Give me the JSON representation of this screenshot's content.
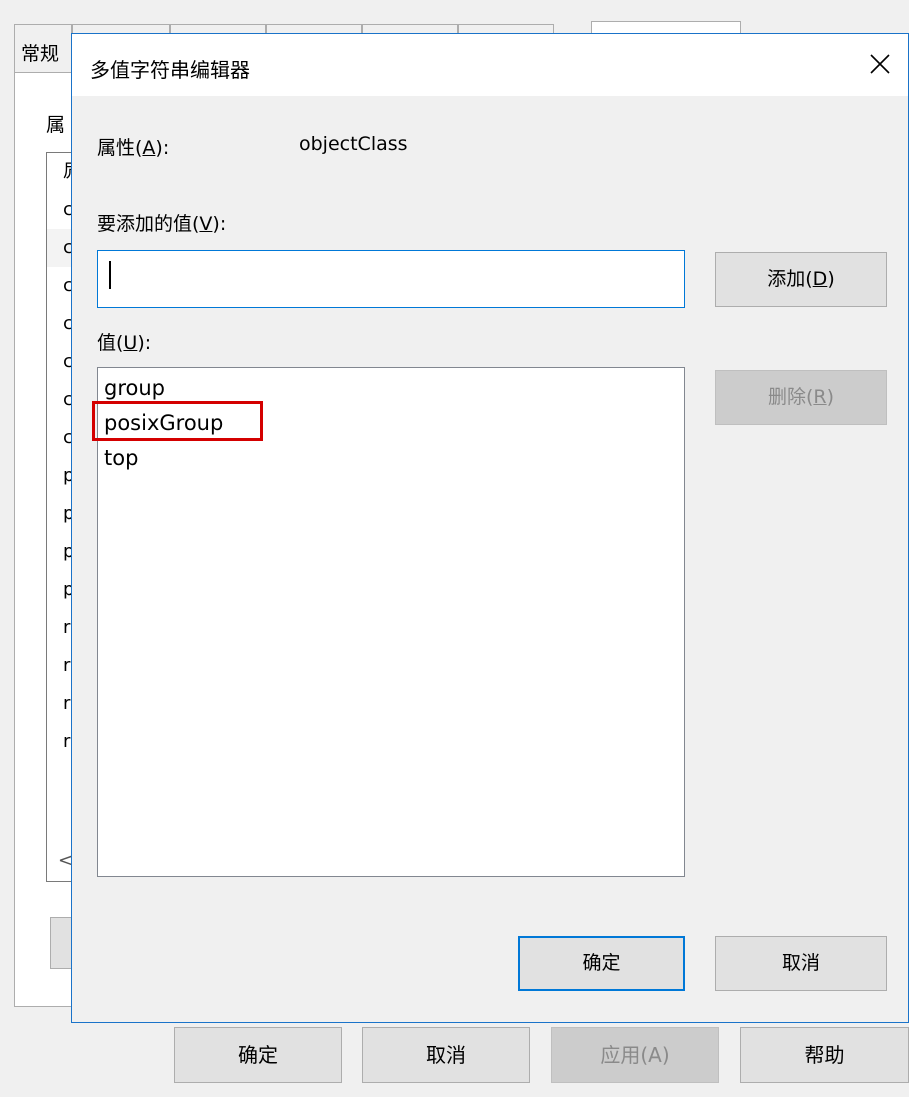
{
  "background_window": {
    "tabs": [
      {
        "label": "常规"
      },
      {
        "label": ""
      },
      {
        "label": ""
      },
      {
        "label": ""
      },
      {
        "label": ""
      },
      {
        "label": ""
      },
      {
        "label": ""
      }
    ],
    "attributes_label": "属",
    "list_items": [
      "凥",
      "c",
      "c",
      "c",
      "c",
      "c",
      "c",
      "c",
      "p",
      "p",
      "p",
      "p",
      "r",
      "r",
      "r",
      "r"
    ],
    "scroll_left_glyph": "<",
    "buttons": {
      "ok": "确定",
      "cancel": "取消",
      "apply": "应用(A)",
      "help": "帮助"
    }
  },
  "dialog": {
    "title": "多值字符串编辑器",
    "attribute_label_prefix": "属性(",
    "attribute_label_key": "A",
    "attribute_label_suffix": "):",
    "attribute_value": "objectClass",
    "value_to_add_prefix": "要添加的值(",
    "value_to_add_key": "V",
    "value_to_add_suffix": "):",
    "value_to_add_input": "",
    "add_button_prefix": "添加(",
    "add_button_key": "D",
    "add_button_suffix": ")",
    "values_label_prefix": "值(",
    "values_label_key": "U",
    "values_label_suffix": "):",
    "values": [
      "group",
      "posixGroup",
      "top"
    ],
    "remove_button_prefix": "删除(",
    "remove_button_key": "R",
    "remove_button_suffix": ")",
    "ok_button": "确定",
    "cancel_button": "取消"
  },
  "colors": {
    "accent": "#0078d7",
    "annotation_highlight": "#d40000"
  }
}
